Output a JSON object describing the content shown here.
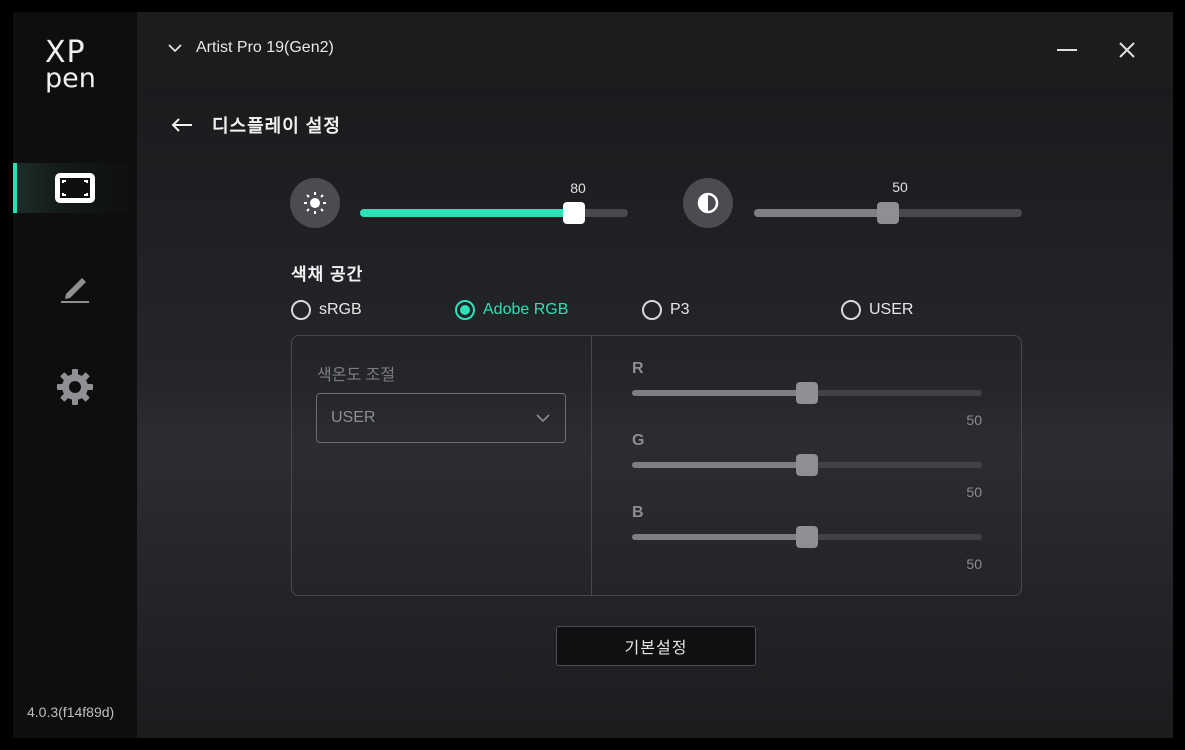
{
  "sidebar": {
    "logo_top": "XP",
    "logo_bottom": "pen",
    "items": [
      {
        "icon": "display-icon",
        "active": true
      },
      {
        "icon": "pen-icon",
        "active": false
      },
      {
        "icon": "gear-icon",
        "active": false
      }
    ],
    "version": "4.0.3(f14f89d)"
  },
  "titlebar": {
    "device_name": "Artist Pro 19(Gen2)"
  },
  "page": {
    "title": "디스플레이 설정"
  },
  "brightness": {
    "value": "80",
    "level_percent": 80
  },
  "contrast": {
    "value": "50",
    "level_percent": 50
  },
  "color_space": {
    "label": "색채 공간",
    "options": [
      {
        "label": "sRGB",
        "checked": false
      },
      {
        "label": "Adobe RGB",
        "checked": true
      },
      {
        "label": "P3",
        "checked": false
      },
      {
        "label": "USER",
        "checked": false
      }
    ]
  },
  "color_temp": {
    "label": "색온도 조절",
    "selected": "USER"
  },
  "rgb": [
    {
      "label": "R",
      "value": "50",
      "level_percent": 50
    },
    {
      "label": "G",
      "value": "50",
      "level_percent": 50
    },
    {
      "label": "B",
      "value": "50",
      "level_percent": 50
    }
  ],
  "reset_label": "기본설정",
  "colors": {
    "accent": "#2ee0b8",
    "background": "#17181a"
  }
}
